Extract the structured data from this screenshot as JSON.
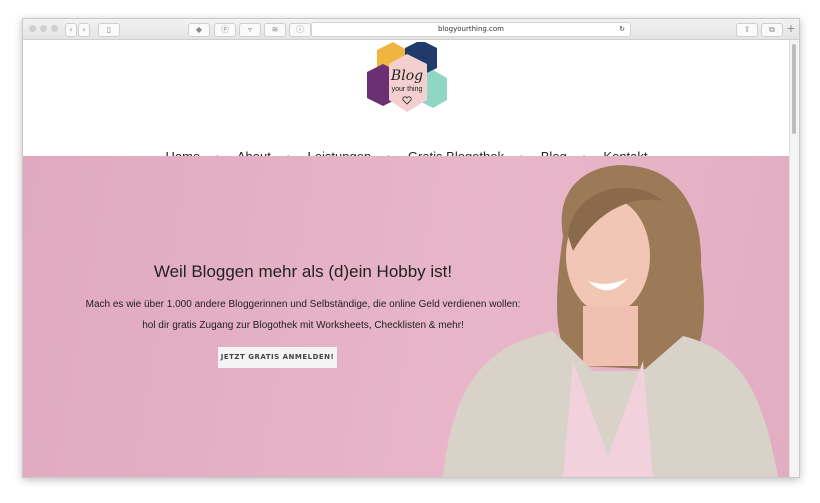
{
  "browser": {
    "url": "blogyourthing.com",
    "icons": [
      "close-dot",
      "minimize-dot",
      "zoom-dot",
      "back-icon",
      "forward-icon",
      "sidebar-icon",
      "tag-icon",
      "pinterest-icon",
      "pocket-icon",
      "buffer-icon",
      "info-icon",
      "reload-icon",
      "share-icon",
      "tabs-icon",
      "new-tab-icon"
    ]
  },
  "logo": {
    "text": "Blog your thing",
    "colors": [
      "#f0b440",
      "#1f3a6b",
      "#6b2f73",
      "#8fd6c4",
      "#f4cfd0"
    ]
  },
  "nav": {
    "items": [
      {
        "label": "Home"
      },
      {
        "label": "About"
      },
      {
        "label": "Leistungen"
      },
      {
        "label": "Gratis Blogothek"
      },
      {
        "label": "Blog"
      },
      {
        "label": "Kontakt"
      }
    ],
    "separator": "➛"
  },
  "hero": {
    "headline": "Weil Bloggen mehr als (d)ein Hobby ist!",
    "line1": "Mach es wie über 1.000 andere Bloggerinnen und Selbständige, die online Geld verdienen wollen:",
    "line2": "hol dir gratis Zugang zur Blogothek mit Worksheets, Checklisten & mehr!",
    "cta": "JETZT GRATIS ANMELDEN!",
    "background": "#e4b0c4"
  }
}
